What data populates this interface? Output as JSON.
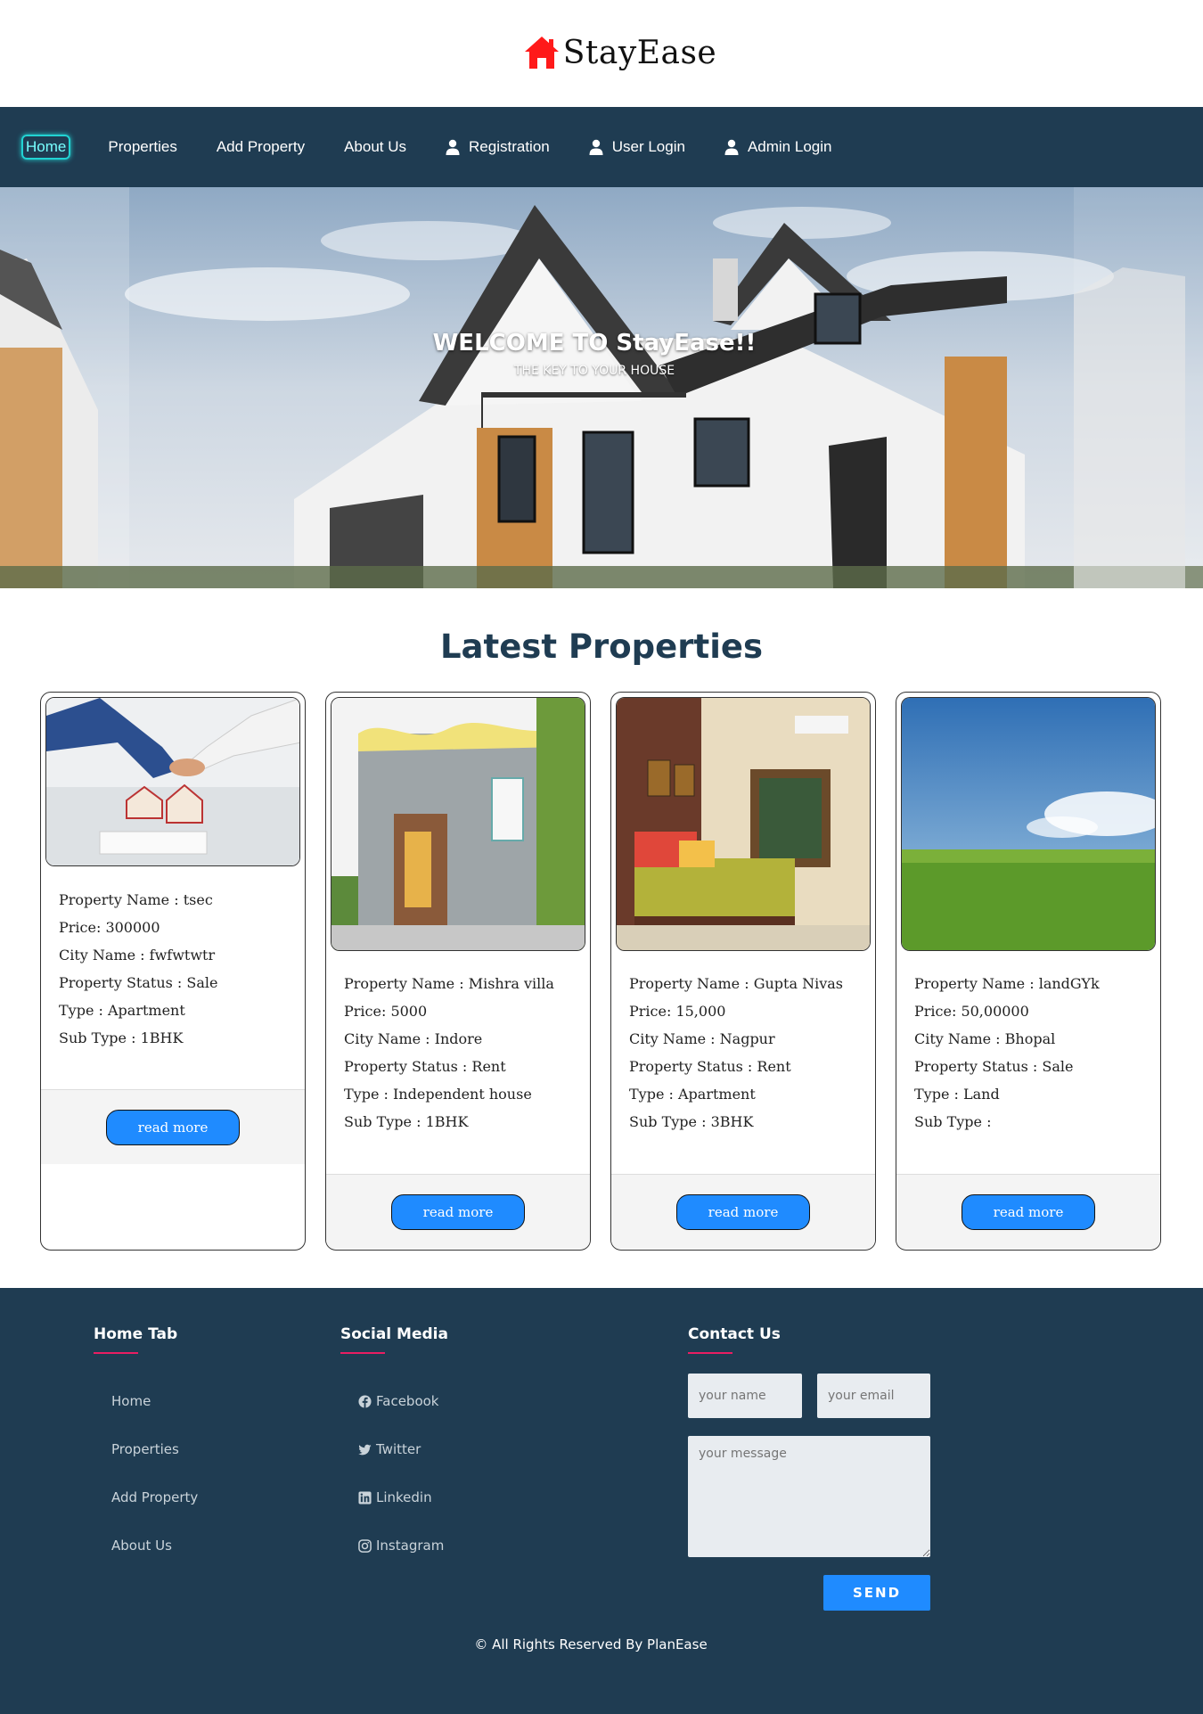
{
  "brand": {
    "name": "StayEase",
    "icon": "house-icon",
    "icon_color": "#ff0000"
  },
  "nav": {
    "items": [
      {
        "label": "Home",
        "active": true
      },
      {
        "label": "Properties"
      },
      {
        "label": "Add Property"
      },
      {
        "label": "About Us"
      },
      {
        "label": "Registration",
        "icon": "user-icon"
      },
      {
        "label": "User Login",
        "icon": "user-icon"
      },
      {
        "label": "Admin Login",
        "icon": "user-icon"
      }
    ]
  },
  "hero": {
    "title": "WELCOME TO StayEase!!",
    "subtitle": "THE KEY TO YOUR HOUSE"
  },
  "latest": {
    "title": "Latest Properties",
    "labels": {
      "name": "Property Name : ",
      "price": "Price: ",
      "city": "City Name : ",
      "status": "Property Status : ",
      "type": "Type : ",
      "subtype": "Sub Type : "
    },
    "read_more": "read more",
    "cards": [
      {
        "name": "tsec",
        "price": "300000",
        "city": "fwfwtwtr",
        "status": "Sale",
        "type": "Apartment",
        "subtype": "1BHK"
      },
      {
        "name": "Mishra villa",
        "price": "5000",
        "city": "Indore",
        "status": "Rent",
        "type": "Independent house",
        "subtype": "1BHK"
      },
      {
        "name": "Gupta Nivas",
        "price": "15,000",
        "city": "Nagpur",
        "status": "Rent",
        "type": "Apartment",
        "subtype": "3BHK"
      },
      {
        "name": "landGYk",
        "price": "50,00000",
        "city": "Bhopal",
        "status": "Sale",
        "type": "Land",
        "subtype": ""
      }
    ]
  },
  "footer": {
    "home_tab": {
      "title": "Home Tab",
      "links": [
        "Home",
        "Properties",
        "Add Property",
        "About Us"
      ]
    },
    "social": {
      "title": "Social Media",
      "links": [
        {
          "label": "Facebook",
          "icon": "facebook-icon"
        },
        {
          "label": "Twitter",
          "icon": "twitter-icon"
        },
        {
          "label": "Linkedin",
          "icon": "linkedin-icon"
        },
        {
          "label": "Instagram",
          "icon": "instagram-icon"
        }
      ]
    },
    "contact": {
      "title": "Contact Us",
      "name_placeholder": "your name",
      "email_placeholder": "your email",
      "message_placeholder": "your message",
      "send_label": "SEND"
    },
    "copyright": "© All Rights Reserved By PlanEase"
  },
  "colors": {
    "nav_bg": "#1f3c52",
    "accent": "#1f8bff",
    "underline": "#e91e63",
    "title": "#1f3c52"
  }
}
